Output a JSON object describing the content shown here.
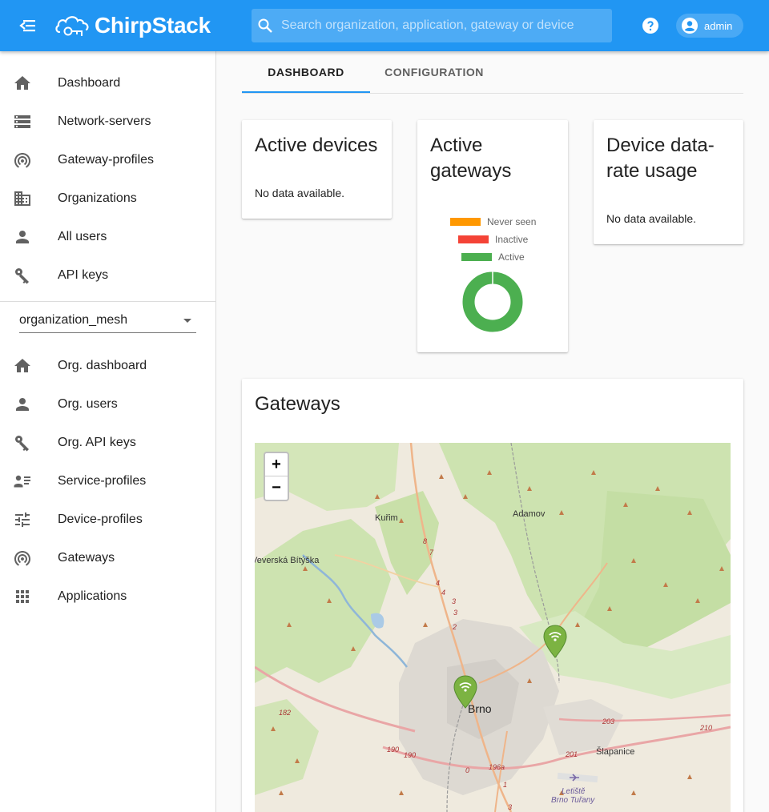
{
  "header": {
    "brand": "ChirpStack",
    "search_placeholder": "Search organization, application, gateway or device",
    "user": "admin"
  },
  "sidebar": {
    "global_items": [
      {
        "label": "Dashboard",
        "icon": "home-icon"
      },
      {
        "label": "Network-servers",
        "icon": "storage-icon"
      },
      {
        "label": "Gateway-profiles",
        "icon": "wifi-tethering-icon"
      },
      {
        "label": "Organizations",
        "icon": "domain-icon"
      },
      {
        "label": "All users",
        "icon": "person-icon"
      },
      {
        "label": "API keys",
        "icon": "key-icon"
      }
    ],
    "organization": "organization_mesh",
    "org_items": [
      {
        "label": "Org. dashboard",
        "icon": "home-icon"
      },
      {
        "label": "Org. users",
        "icon": "person-icon"
      },
      {
        "label": "Org. API keys",
        "icon": "key-icon"
      },
      {
        "label": "Service-profiles",
        "icon": "account-details-icon"
      },
      {
        "label": "Device-profiles",
        "icon": "tune-icon"
      },
      {
        "label": "Gateways",
        "icon": "wifi-tethering-icon"
      },
      {
        "label": "Applications",
        "icon": "apps-icon"
      }
    ]
  },
  "tabs": {
    "dashboard": "DASHBOARD",
    "configuration": "CONFIGURATION"
  },
  "cards": {
    "active_devices": {
      "title": "Active devices",
      "empty": "No data available."
    },
    "active_gateways": {
      "title_line1": "Active",
      "title_line2": "gateways",
      "legend": [
        {
          "label": "Never seen",
          "color": "#ff9800"
        },
        {
          "label": "Inactive",
          "color": "#f44336"
        },
        {
          "label": "Active",
          "color": "#4caf50"
        }
      ]
    },
    "device_datarate": {
      "title_line1": "Device data-",
      "title_line2": "rate usage",
      "empty": "No data available."
    },
    "gateways_map": {
      "title": "Gateways"
    }
  },
  "map": {
    "zoom_in": "+",
    "zoom_out": "−",
    "labels": {
      "kurim": "Kuřim",
      "adamov": "Adamov",
      "bityska": "Veverská Bítýška",
      "brno": "Brno",
      "slapanice": "Šlapanice",
      "airport_line1": "Letiště",
      "airport_line2": "Brno Tuřany",
      "road_182": "182",
      "road_190a": "190",
      "road_190b": "190",
      "road_196a": "196a",
      "road_201": "201",
      "road_203": "203",
      "road_210": "210",
      "road_0": "0",
      "road_1": "1",
      "road_2": "2",
      "road_3a": "3",
      "road_3b": "3",
      "road_3c": "3",
      "road_4a": "4",
      "road_4b": "4",
      "road_7": "7",
      "road_8": "8"
    }
  },
  "chart_data": {
    "type": "pie",
    "title": "Active gateways",
    "categories": [
      "Never seen",
      "Inactive",
      "Active"
    ],
    "values": [
      0,
      0,
      2
    ],
    "colors": [
      "#ff9800",
      "#f44336",
      "#4caf50"
    ],
    "legend": "top"
  }
}
